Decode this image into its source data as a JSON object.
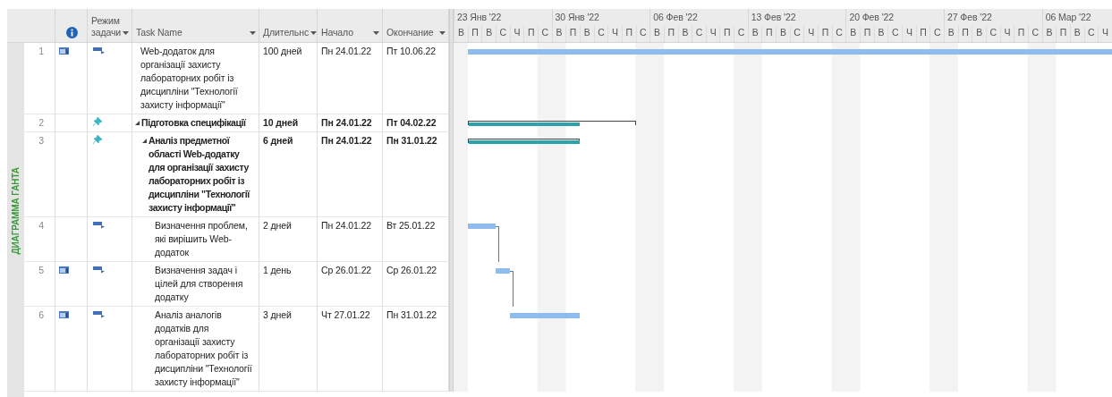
{
  "side_label": "ДИАГРАММА ГАНТА",
  "columns": [
    {
      "kind": "info"
    },
    {
      "kind": "text",
      "label": "Режим задачи"
    },
    {
      "kind": "text",
      "label": "Task Name"
    },
    {
      "kind": "text",
      "label": "Длительнс"
    },
    {
      "kind": "text",
      "label": "Начало"
    },
    {
      "kind": "text",
      "label": "Окончание"
    }
  ],
  "timeline": {
    "weeks": [
      {
        "label": "23 Янв '22",
        "days": [
          "В",
          "П",
          "В",
          "С",
          "Ч",
          "П",
          "С"
        ]
      },
      {
        "label": "30 Янв '22",
        "days": [
          "В",
          "П",
          "В",
          "С",
          "Ч",
          "П",
          "С"
        ]
      },
      {
        "label": "06 Фев '22",
        "days": [
          "В",
          "П",
          "В",
          "С",
          "Ч",
          "П",
          "С"
        ]
      },
      {
        "label": "13 Фев '22",
        "days": [
          "В",
          "П",
          "В",
          "С",
          "Ч",
          "П",
          "С"
        ]
      },
      {
        "label": "20 Фев '22",
        "days": [
          "В",
          "П",
          "В",
          "С",
          "Ч",
          "П",
          "С"
        ]
      },
      {
        "label": "27 Фев '22",
        "days": [
          "В",
          "П",
          "В",
          "С",
          "Ч",
          "П",
          "С"
        ]
      },
      {
        "label": "06 Мар '22",
        "days": [
          "В",
          "П",
          "В",
          "С",
          "Ч"
        ]
      }
    ]
  },
  "tasks": [
    {
      "number": "1",
      "kind": "task",
      "indicator": true,
      "pinned": false,
      "name": "Web-додаток для організації захисту лабораторних робіт із дисципліни \"Технології захисту інформації\"",
      "duration": "100 дней",
      "start": "Пн 24.01.22",
      "finish": "Пт 10.06.22",
      "linked_to_previous": false
    },
    {
      "number": "2",
      "kind": "summary",
      "indicator": false,
      "pinned": true,
      "name": "Підготовка специфікації",
      "duration": "10 дней",
      "start": "Пн 24.01.22",
      "finish": "Пт 04.02.22",
      "linked_to_previous": false,
      "children": [
        {
          "number": "3",
          "kind": "summary",
          "indicator": false,
          "pinned": true,
          "name": "Аналіз предметної області Web-додатку для організації захисту лабораторних робіт із дисципліни \"Технології захисту інформації\"",
          "duration": "6 дней",
          "start": "Пн 24.01.22",
          "finish": "Пн 31.01.22",
          "linked_to_previous": false,
          "children": [
            {
              "number": "4",
              "kind": "task",
              "indicator": false,
              "pinned": false,
              "name": "Визначення проблем, які вирішить Web-додаток",
              "duration": "2 дней",
              "start": "Пн 24.01.22",
              "finish": "Вт 25.01.22",
              "linked_to_previous": false
            },
            {
              "number": "5",
              "kind": "task",
              "indicator": true,
              "pinned": false,
              "name": "Визначення задач і цілей для створення додатку",
              "duration": "1 день",
              "start": "Ср 26.01.22",
              "finish": "Ср 26.01.22",
              "linked_to_previous": true
            },
            {
              "number": "6",
              "kind": "task",
              "indicator": true,
              "pinned": false,
              "name": "Аналіз аналогів додатків для організації захисту лабораторних робіт із дисципліни \"Технології захисту інформації\"",
              "duration": "3 дней",
              "start": "Чт 27.01.22",
              "finish": "Пн 31.01.22",
              "linked_to_previous": true
            }
          ]
        }
      ]
    }
  ]
}
